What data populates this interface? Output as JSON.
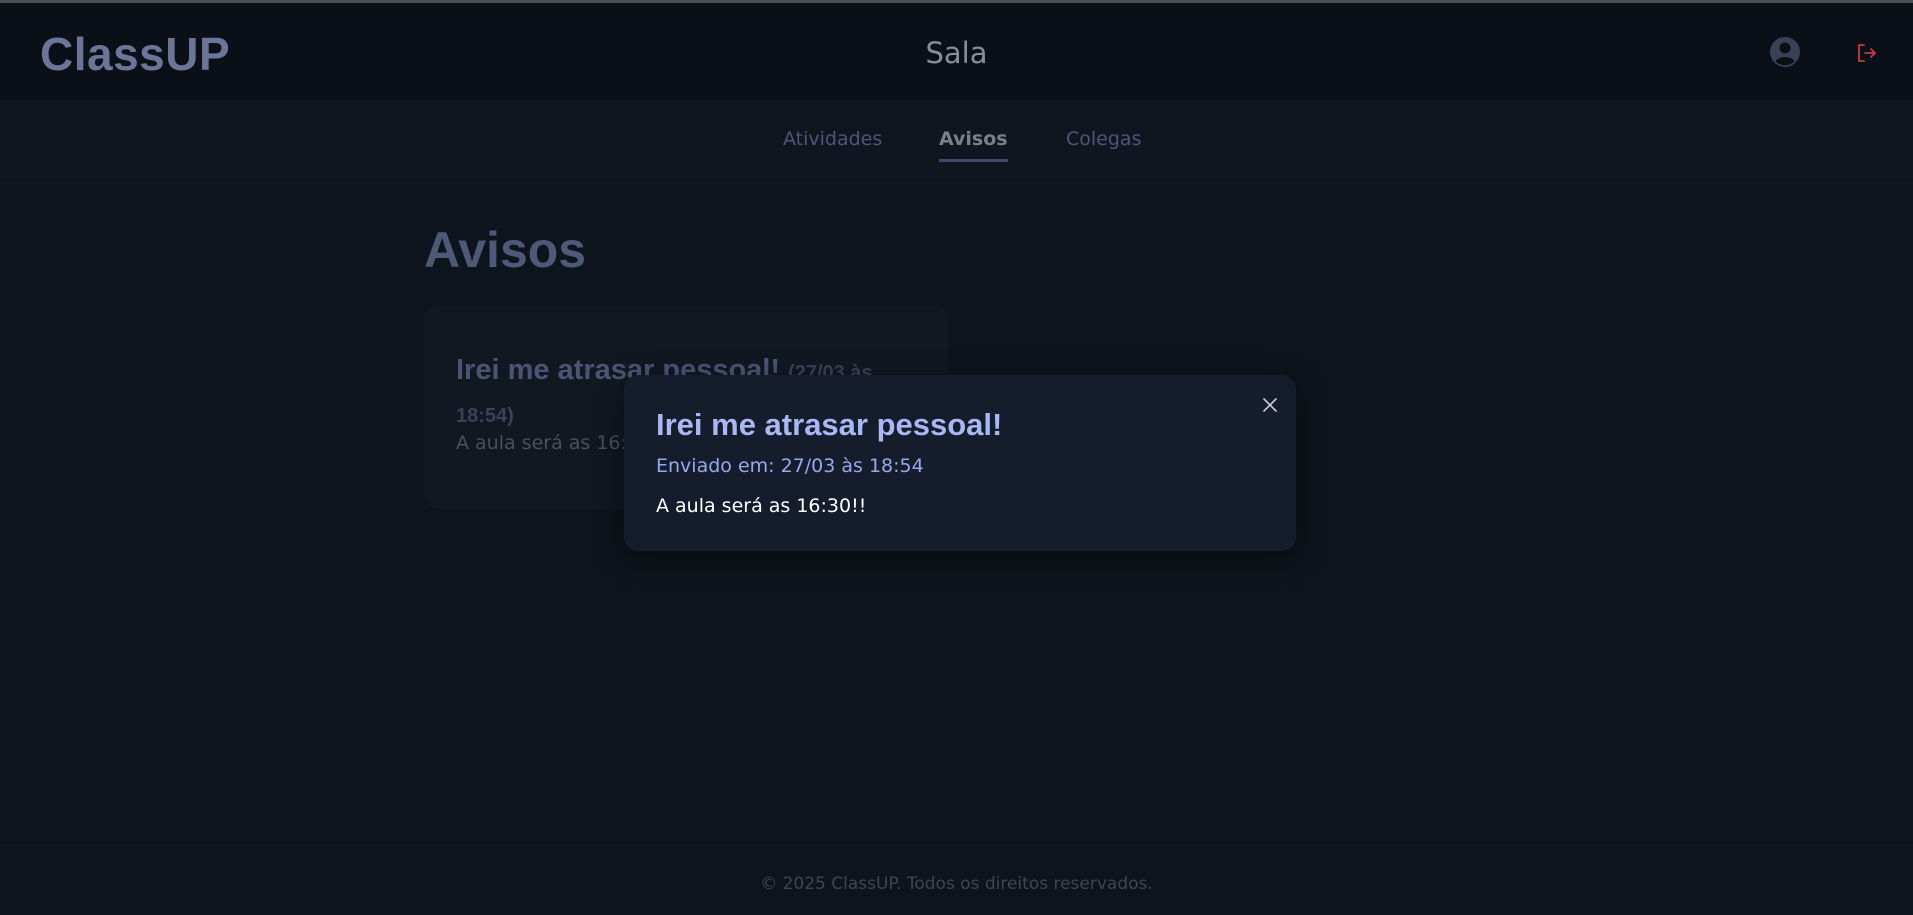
{
  "header": {
    "logo": "ClassUP",
    "title": "Sala",
    "icons": {
      "user": "user-circle-icon",
      "logout": "logout-icon"
    },
    "logout_color": "#c0413f"
  },
  "tabs": [
    {
      "label": "Atividades",
      "active": false
    },
    {
      "label": "Avisos",
      "active": true
    },
    {
      "label": "Colegas",
      "active": false
    }
  ],
  "section": {
    "title": "Avisos"
  },
  "notices": [
    {
      "title": "Irei me atrasar pessoal!",
      "date": "(27/03 às 18:54)",
      "body": "A aula será as 16:30"
    }
  ],
  "modal": {
    "title": "Irei me atrasar pessoal!",
    "sent": "Enviado em: 27/03 às 18:54",
    "body": "A aula será as 16:30!!",
    "close_icon": "close-icon"
  },
  "footer": {
    "text": "© 2025 ClassUP. Todos os direitos reservados."
  },
  "colors": {
    "background": "#0e141d",
    "modal_bg": "#151c2b",
    "accent": "#a9b8f4"
  }
}
